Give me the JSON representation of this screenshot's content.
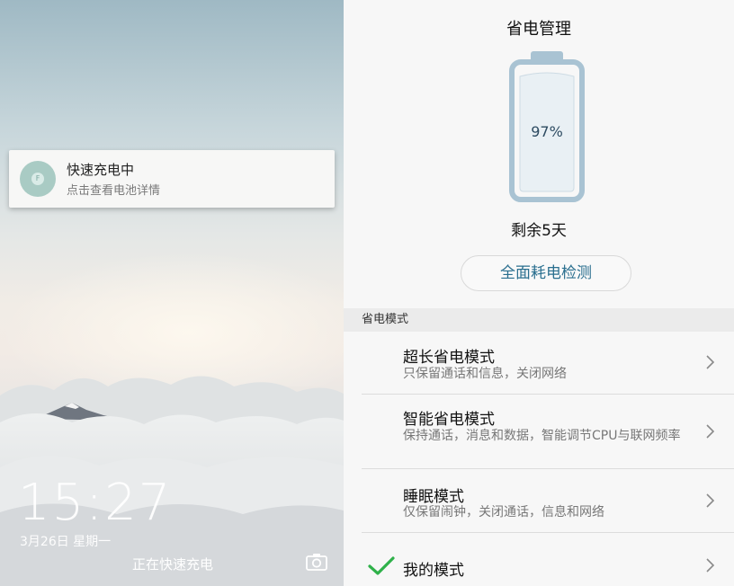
{
  "lockscreen": {
    "notification": {
      "title": "快速充电中",
      "subtitle": "点击查看电池详情",
      "icon": "charging-icon",
      "icon_glyph": "F"
    },
    "clock": "15:27",
    "date": "3月26日 星期一",
    "charging_status": "正在快速充电",
    "camera_icon": "camera-icon"
  },
  "power": {
    "title": "省电管理",
    "battery_percent": "97%",
    "battery_level": 0.97,
    "remaining": "剩余5天",
    "check_button": "全面耗电检测",
    "section_title": "省电模式",
    "modes": [
      {
        "title": "超长省电模式",
        "desc": "只保留通话和信息，关闭网络"
      },
      {
        "title": "智能省电模式",
        "desc": "保持通话，消息和数据，智能调节CPU与联网频率"
      },
      {
        "title": "睡眠模式",
        "desc": "仅保留闹钟，关闭通话，信息和网络"
      },
      {
        "title": "我的模式",
        "desc": "",
        "selected": true
      }
    ]
  },
  "colors": {
    "accent": "#2a6f8f",
    "check": "#2fb14a",
    "battery_outline": "#a9c3d3"
  }
}
